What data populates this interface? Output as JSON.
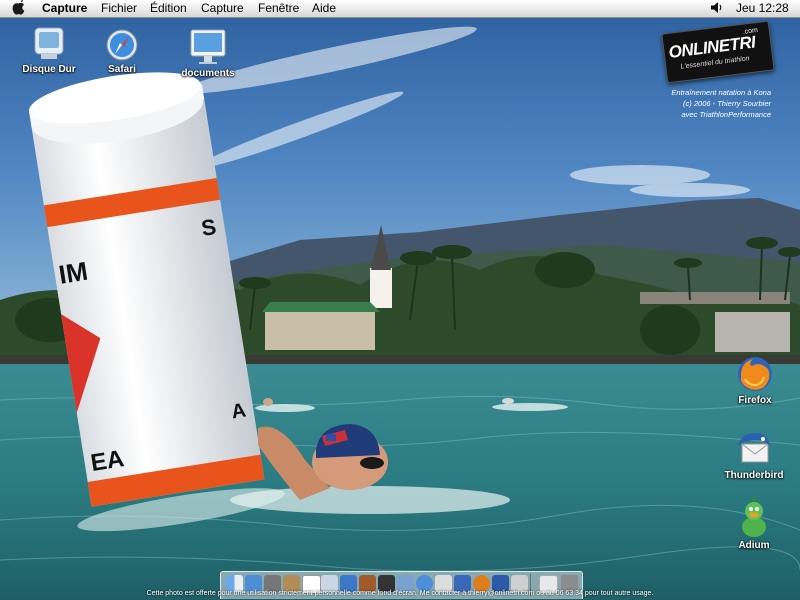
{
  "menubar": {
    "app_name": "Capture",
    "menus": [
      "Fichier",
      "Édition",
      "Capture",
      "Fenêtre",
      "Aide"
    ],
    "clock": "Jeu 12:28"
  },
  "desktop": {
    "icons": [
      {
        "label": "Disque Dur",
        "icon": "hard-disk-icon"
      },
      {
        "label": "Safari",
        "icon": "safari-compass-icon"
      },
      {
        "label": "documents",
        "icon": "imac-icon"
      },
      {
        "label": "Firefox",
        "icon": "firefox-icon"
      },
      {
        "label": "Thunderbird",
        "icon": "thunderbird-icon"
      },
      {
        "label": "Adium",
        "icon": "adium-duck-icon"
      }
    ]
  },
  "logo": {
    "main": "ONLINETRI",
    "suffix": ".com",
    "tagline": "L'essentiel du triathlon"
  },
  "credits": [
    "Entraînement natation à Kona",
    "(c) 2006 - Thierry Sourbier",
    "avec TriathlonPerformance"
  ],
  "wallpaper": {
    "buoy_text_left": "IM",
    "buoy_text_right": "S",
    "buoy_text_bottom": "EA",
    "buoy_text_bottom_right": "A"
  },
  "dock": {
    "items": [
      "Finder",
      "Aperçu",
      "Capture",
      "Dictionnaire",
      "iCal",
      "iTunes",
      "iPhoto",
      "iMovie",
      "Mail",
      "iChat",
      "Aperçu",
      "Firefox",
      "Safari",
      "Préférences Système",
      "Documents",
      "Corbeille"
    ]
  },
  "footer": "Cette photo est offerte pour une utilisation strictement personnelle comme fond d'écran. Me contacter à thierry@onlinetri.com ou au 06 63 34 pour tout autre usage."
}
